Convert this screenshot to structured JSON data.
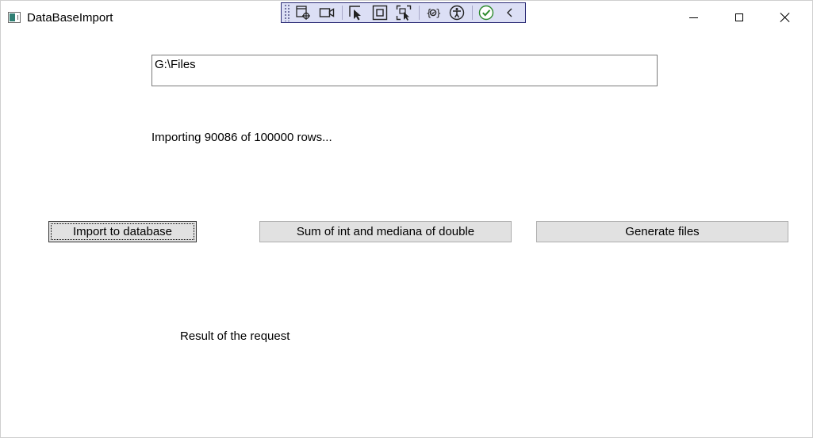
{
  "window": {
    "title": "DataBaseImport"
  },
  "toolbar": {
    "icons": [
      "select-element-icon",
      "record-icon",
      "selection-pointer-icon",
      "display-layout-adorners-icon",
      "track-focused-element-icon",
      "binding-failures-icon",
      "accessibility-icon",
      "check-icon",
      "collapse-icon"
    ],
    "accent": "#2c2c76",
    "background": "#dcdff5"
  },
  "form": {
    "path_value": "G:\\Files",
    "status_text": "Importing 90086 of 100000 rows...",
    "buttons": {
      "import": "Import to database",
      "sum": "Sum of int and mediana of double",
      "generate": "Generate files"
    },
    "result_text": "Result of the request"
  }
}
